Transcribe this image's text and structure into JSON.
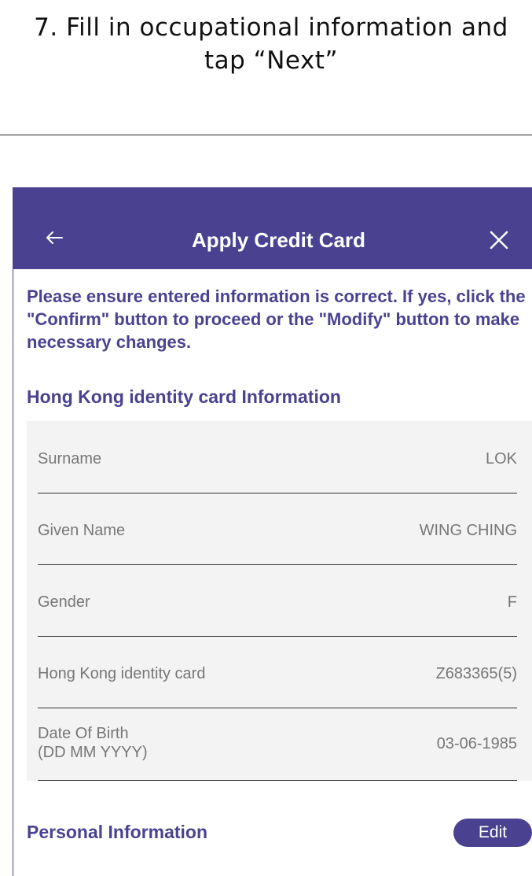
{
  "instruction": {
    "line1": "7. Fill in occupational information and",
    "line2": "tap “Next”"
  },
  "navbar": {
    "title": "Apply Credit Card",
    "back_icon": "arrow-left-icon",
    "close_icon": "close-icon",
    "background_color": "#4a4290"
  },
  "notice": "Please ensure entered information is correct. If yes, click the \"Confirm\" button to proceed or the \"Modify\" button to make necessary changes.",
  "sections": {
    "hkid_title": "Hong Kong identity card Information",
    "personal_title": "Personal Information",
    "edit_label": "Edit"
  },
  "hkid": {
    "surname": {
      "label": "Surname",
      "value": "LOK"
    },
    "given_name": {
      "label": "Given Name",
      "value": "WING CHING"
    },
    "gender": {
      "label": "Gender",
      "value": "F"
    },
    "id_card": {
      "label": "Hong Kong identity card",
      "value": "Z683365(5)"
    },
    "dob": {
      "label_line1": "Date Of Birth",
      "label_line2": "(DD MM YYYY)",
      "value": "03-06-1985"
    }
  },
  "colors": {
    "accent": "#4a4290",
    "card_background": "#f3f3f3",
    "muted_text": "#777777"
  }
}
